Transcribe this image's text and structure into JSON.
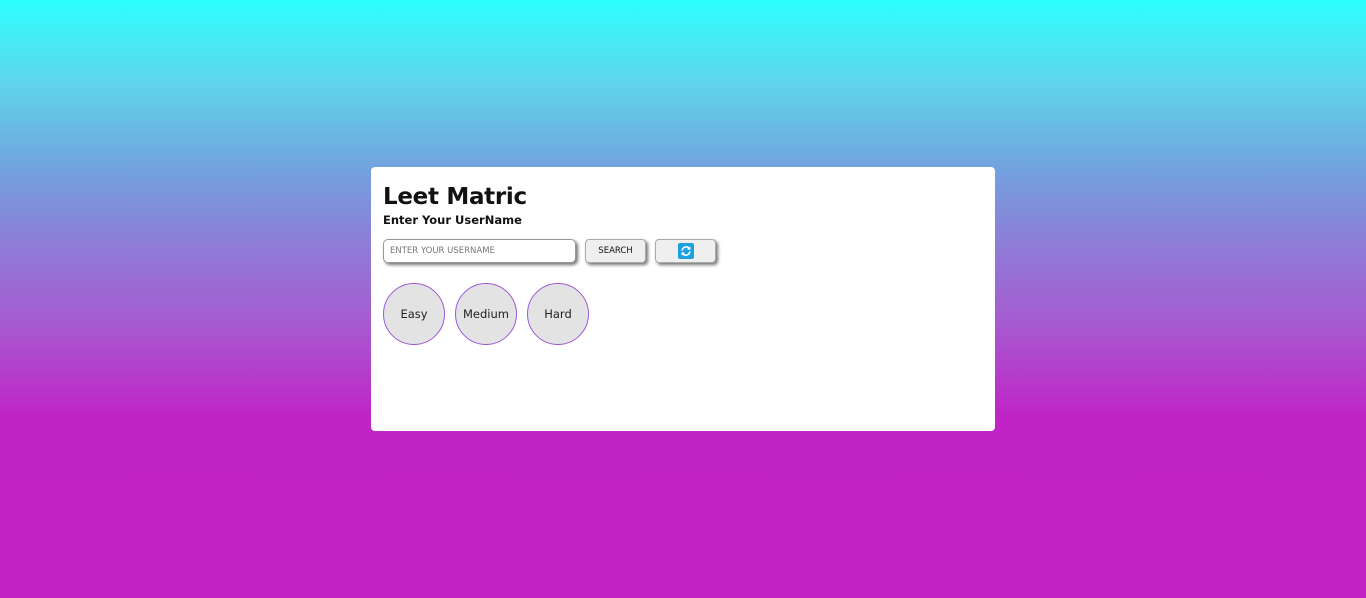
{
  "app": {
    "title": "Leet Matric",
    "subtitle": "Enter Your UserName"
  },
  "search": {
    "placeholder": "ENTER YOUR USERNAME",
    "value": "",
    "button_label": "SEARCH",
    "refresh_icon": "refresh-icon"
  },
  "progress": {
    "items": [
      {
        "label": "Easy"
      },
      {
        "label": "Medium"
      },
      {
        "label": "Hard"
      }
    ]
  },
  "colors": {
    "gradient_top": "#2effff",
    "gradient_bottom": "#c223c5",
    "circle_border": "#9b59d6",
    "circle_fill": "#e3e3e3",
    "refresh_icon": "#1ba1e2"
  }
}
